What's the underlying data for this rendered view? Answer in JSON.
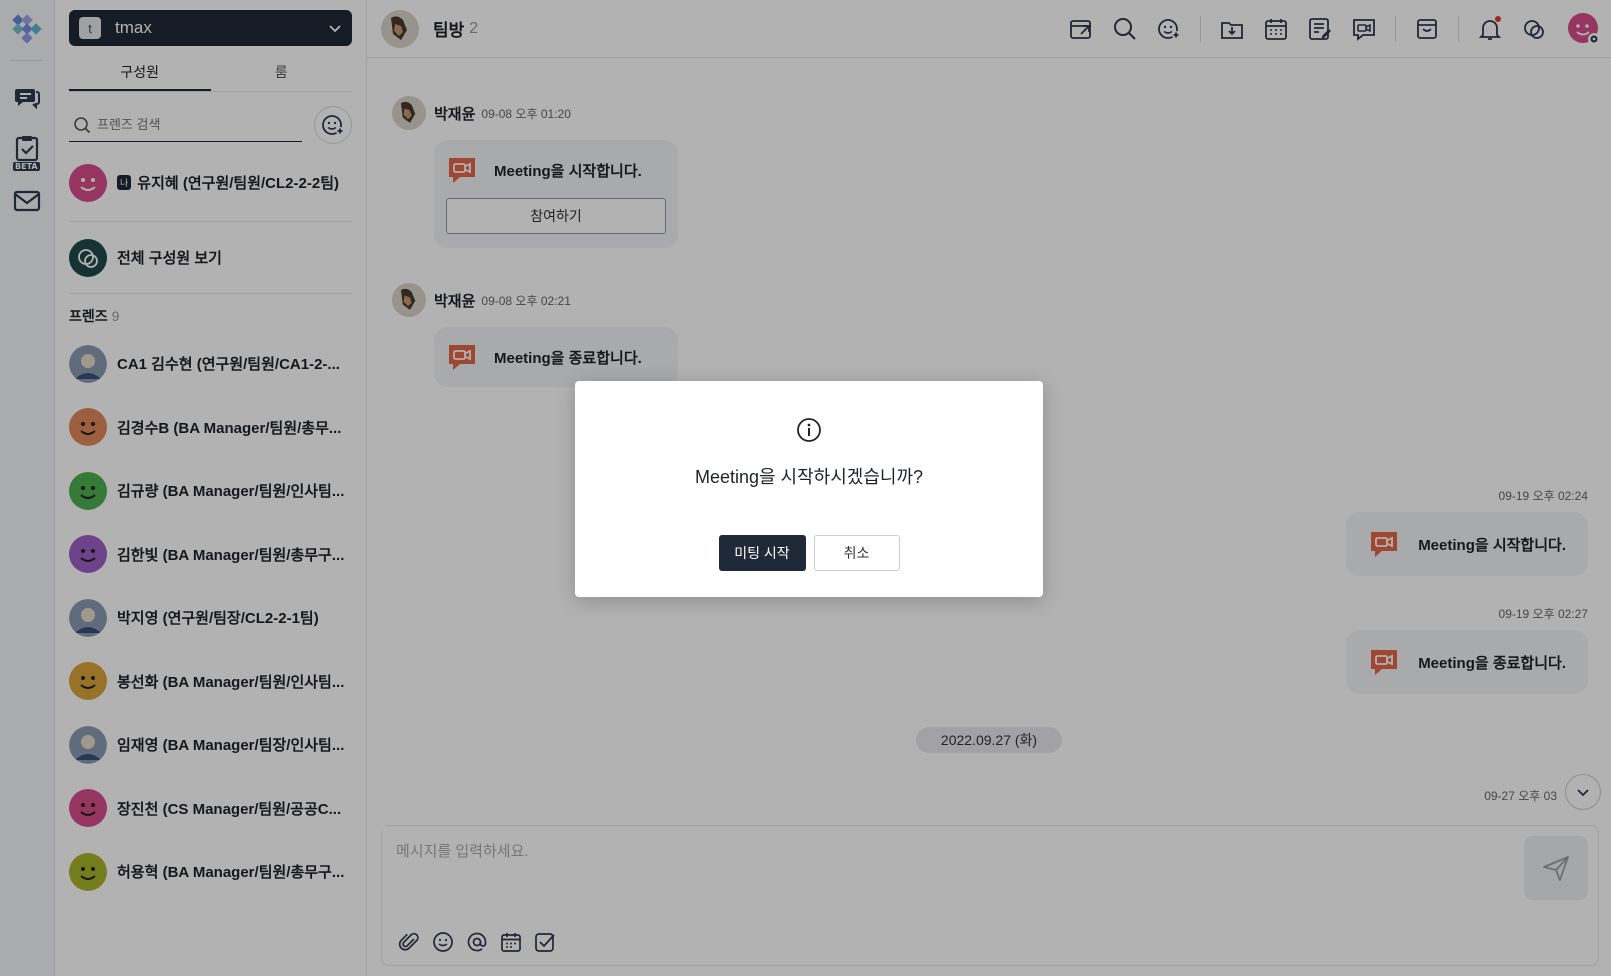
{
  "colors": {
    "accent": "#1f2937",
    "meeting_icon": "#e3664a",
    "notification_dot": "#e53935"
  },
  "workspace": {
    "initial": "t",
    "name": "tmax"
  },
  "sidebar": {
    "tabs": [
      {
        "label": "구성원"
      },
      {
        "label": "룸"
      }
    ],
    "search_placeholder": "프렌즈 검색",
    "me": {
      "tag": "나",
      "name": "유지혜 (연구원/팀원/CL2-2-2팀)"
    },
    "all_members": "전체 구성원 보기",
    "friends_header": "프렌즈",
    "friends_count": "9",
    "friends": [
      {
        "name": "CA1 김수현 (연구원/팀원/CA1-2-...",
        "avatar": "photo"
      },
      {
        "name": "김경수B (BA Manager/팀원/총무...",
        "avatar": "#e08a5a"
      },
      {
        "name": "김규량 (BA Manager/팀원/인사팀...",
        "avatar": "#4caf50"
      },
      {
        "name": "김한빛 (BA Manager/팀원/총무구...",
        "avatar": "#9c5fc7"
      },
      {
        "name": "박지영 (연구원/팀장/CL2-2-1팀)",
        "avatar": "photo"
      },
      {
        "name": "봉선화 (BA Manager/팀원/인사팀...",
        "avatar": "#d9a53b"
      },
      {
        "name": "임재영 (BA Manager/팀장/인사팀...",
        "avatar": "photo"
      },
      {
        "name": "장진천 (CS Manager/팀원/공공C...",
        "avatar": "#d64d8a"
      },
      {
        "name": "허용혁 (BA Manager/팀원/총무구...",
        "avatar": "#a7b52a"
      }
    ]
  },
  "room": {
    "title": "팀방",
    "member_count": "2"
  },
  "messages": [
    {
      "sender": "박재윤",
      "time": "09-08 오후 01:20",
      "text": "Meeting을 시작합니다.",
      "button": "참여하기"
    },
    {
      "sender": "박재윤",
      "time": "09-08 오후 02:21",
      "text": "Meeting을 종료합니다."
    }
  ],
  "my_messages": [
    {
      "time": "09-19 오후 02:24",
      "text": "Meeting을 시작합니다."
    },
    {
      "time": "09-19 오후 02:27",
      "text": "Meeting을 종료합니다."
    }
  ],
  "date_divider": "2022.09.27 (화)",
  "last_time": "09-27 오후 03",
  "composer": {
    "placeholder": "메시지를 입력하세요."
  },
  "dialog": {
    "message": "Meeting을 시작하시겠습니까?",
    "confirm": "미팅 시작",
    "cancel": "취소"
  }
}
